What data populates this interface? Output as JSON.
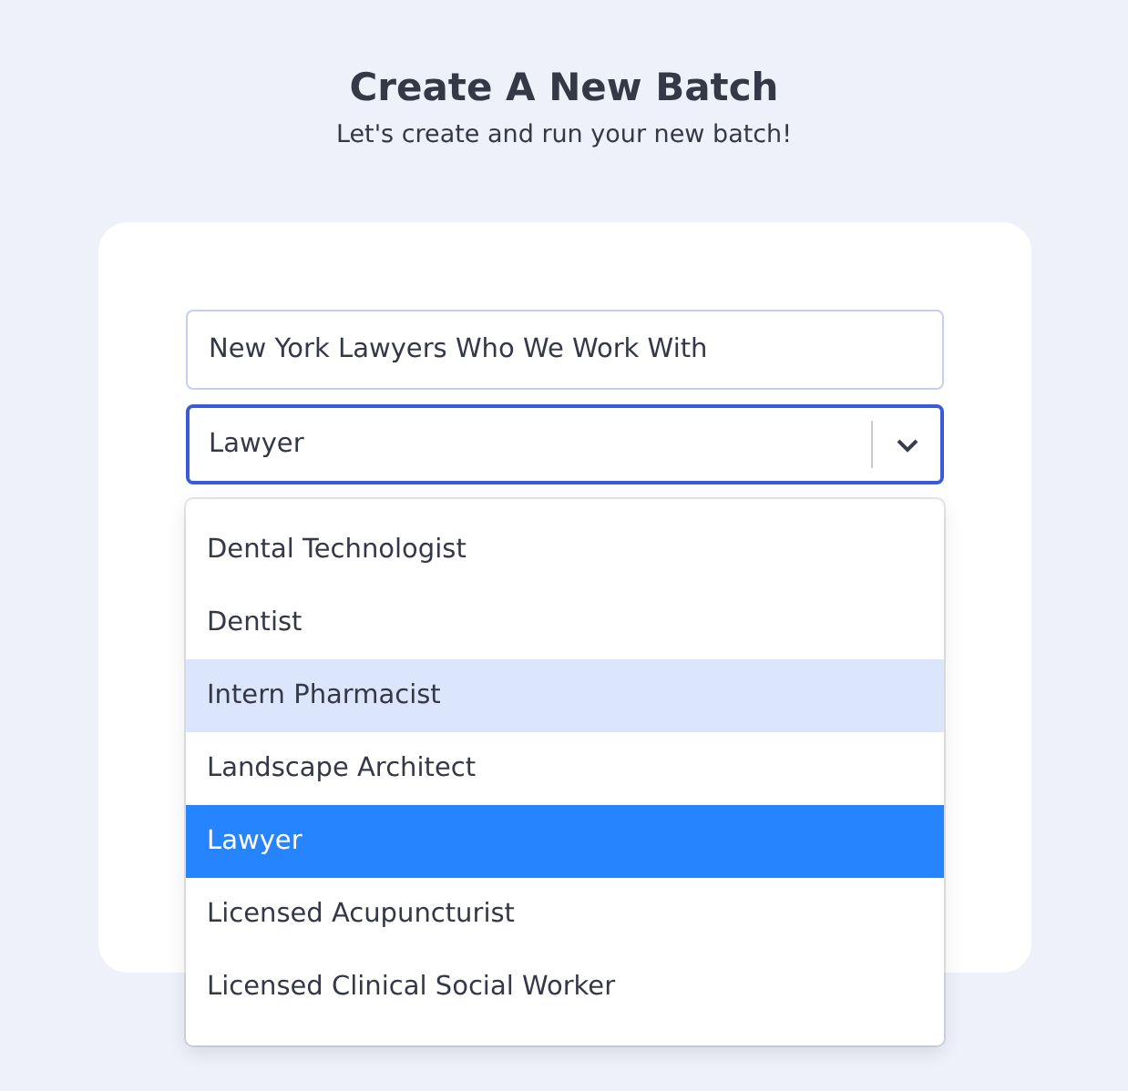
{
  "header": {
    "title": "Create A New Batch",
    "subtitle": "Let's create and run your new batch!"
  },
  "name_field": {
    "value": "New York Lawyers Who We Work With"
  },
  "type_select": {
    "value": "Lawyer",
    "expanded": true,
    "options": [
      {
        "label": "Dental Technologist",
        "selected": false,
        "hovered": false
      },
      {
        "label": "Dentist",
        "selected": false,
        "hovered": false
      },
      {
        "label": "Intern Pharmacist",
        "selected": false,
        "hovered": true
      },
      {
        "label": "Landscape Architect",
        "selected": false,
        "hovered": false
      },
      {
        "label": "Lawyer",
        "selected": true,
        "hovered": false
      },
      {
        "label": "Licensed Acupuncturist",
        "selected": false,
        "hovered": false
      },
      {
        "label": "Licensed Clinical Social Worker",
        "selected": false,
        "hovered": false
      }
    ]
  }
}
